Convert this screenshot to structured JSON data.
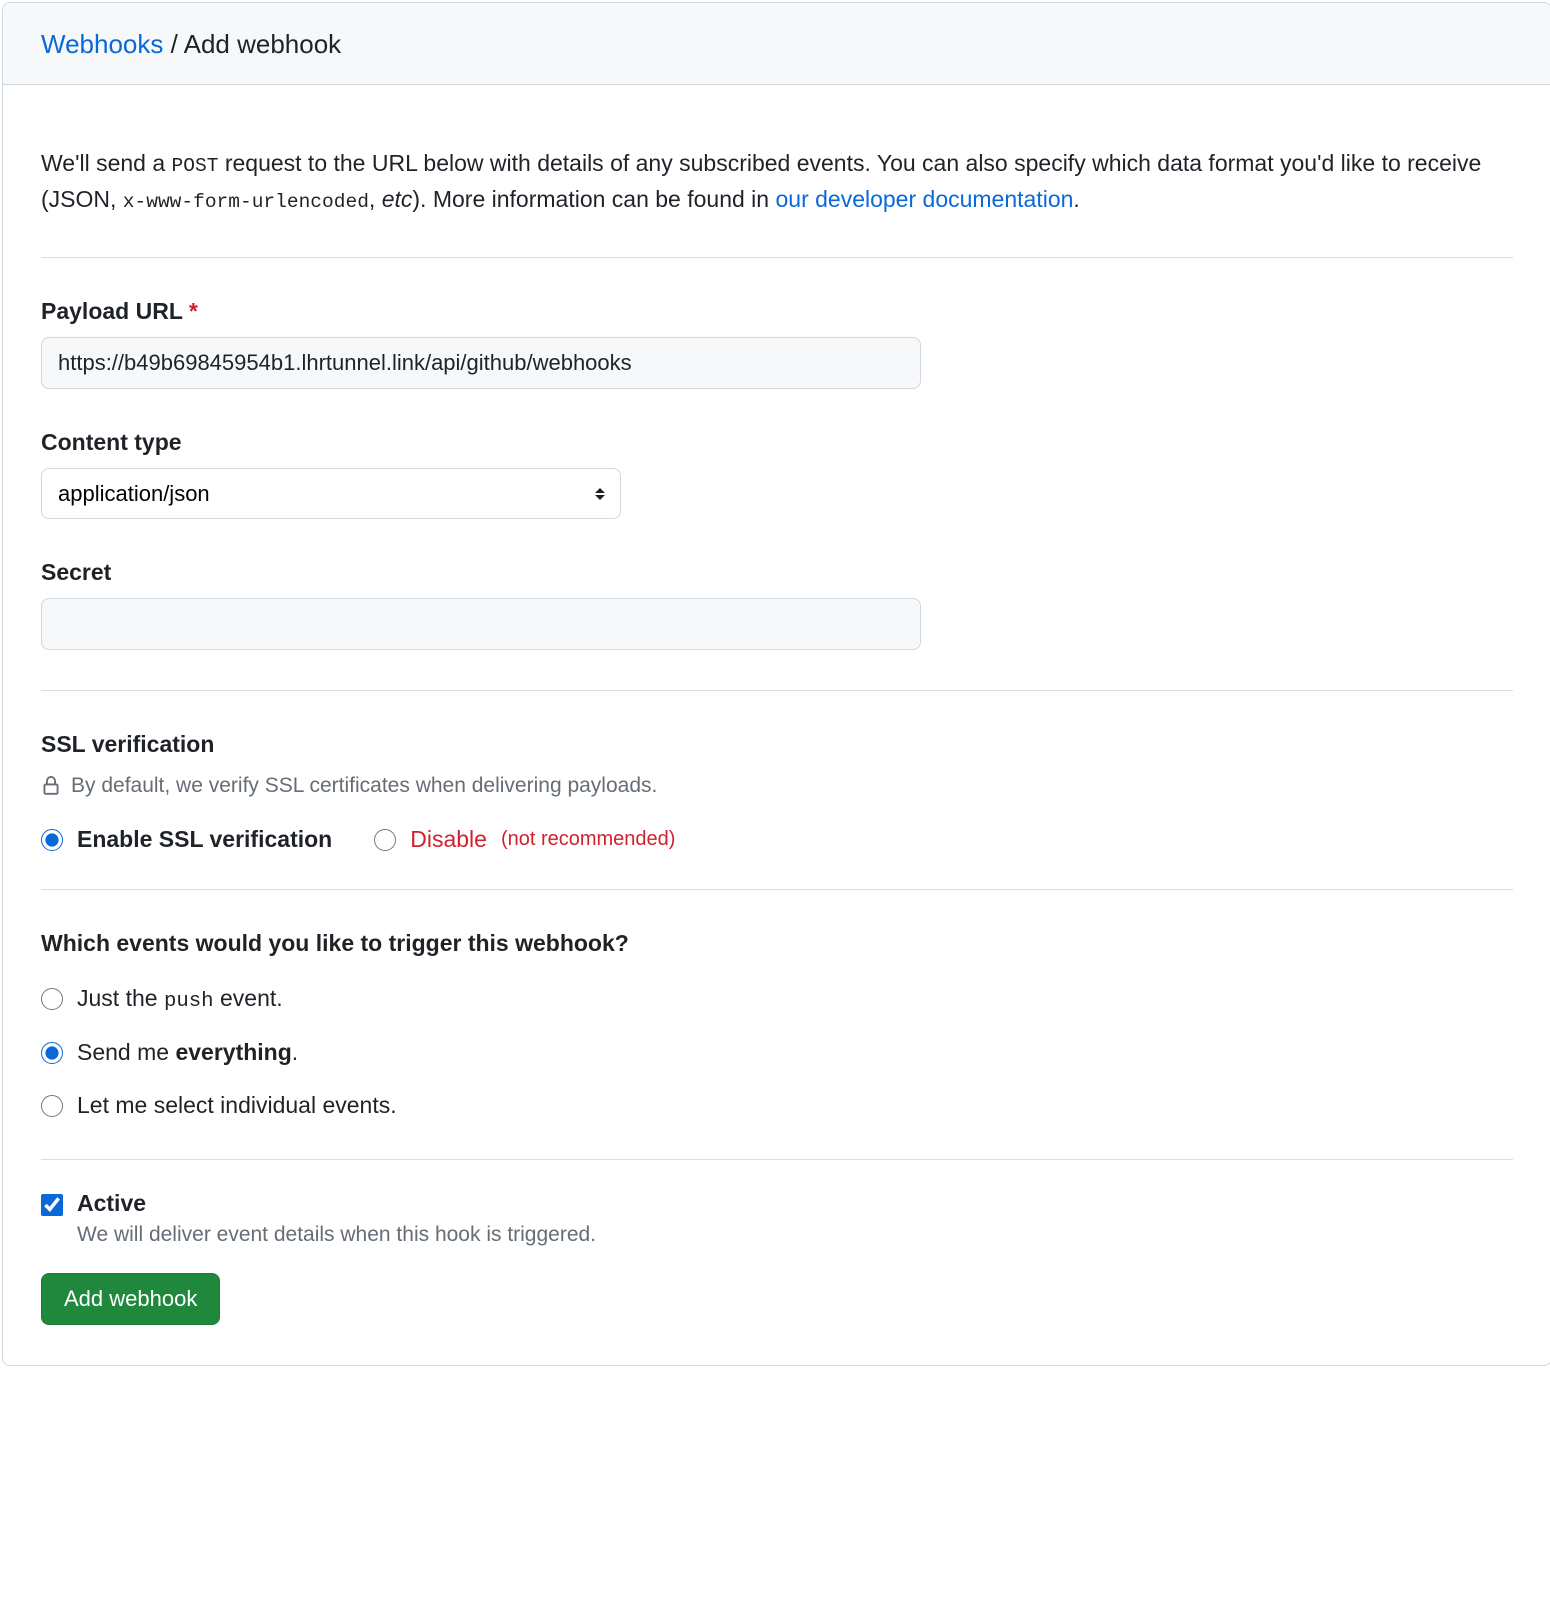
{
  "breadcrumb": {
    "link": "Webhooks",
    "current": "Add webhook"
  },
  "intro": {
    "pre": "We'll send a ",
    "code1": "POST",
    "mid1": " request to the URL below with details of any subscribed events. You can also specify which data format you'd like to receive (JSON, ",
    "code2": "x-www-form-urlencoded",
    "mid2": ", ",
    "etc": "etc",
    "mid3": "). More information can be found in ",
    "link": "our developer documentation",
    "post": "."
  },
  "payload_url": {
    "label": "Payload URL",
    "value": "https://b49b69845954b1.lhrtunnel.link/api/github/webhooks"
  },
  "content_type": {
    "label": "Content type",
    "value": "application/json"
  },
  "secret": {
    "label": "Secret",
    "value": ""
  },
  "ssl": {
    "heading": "SSL verification",
    "note": "By default, we verify SSL certificates when delivering payloads.",
    "enable": "Enable SSL verification",
    "disable": "Disable",
    "disable_sub": "(not recommended)"
  },
  "events": {
    "heading": "Which events would you like to trigger this webhook?",
    "push_pre": "Just the ",
    "push_code": "push",
    "push_post": " event.",
    "everything_pre": "Send me ",
    "everything_strong": "everything",
    "everything_post": ".",
    "individual": "Let me select individual events."
  },
  "active": {
    "label": "Active",
    "desc": "We will deliver event details when this hook is triggered."
  },
  "submit": "Add webhook"
}
